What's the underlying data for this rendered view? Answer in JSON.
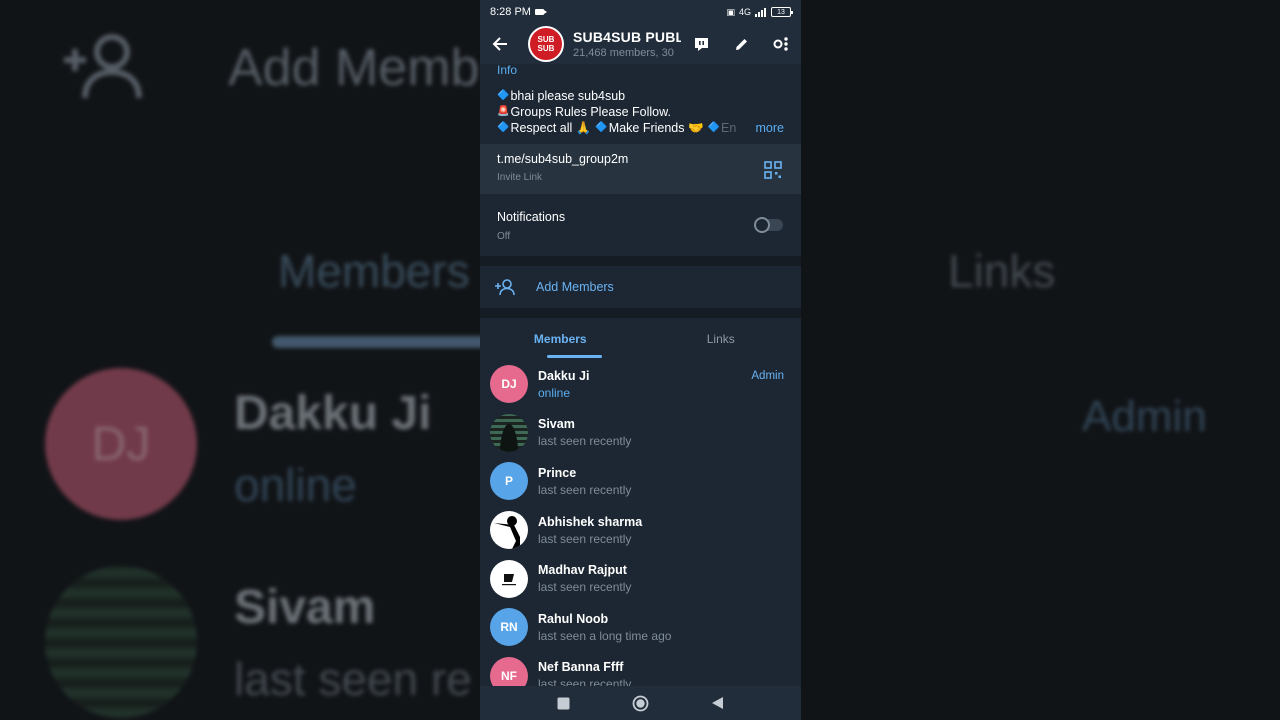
{
  "background": {
    "add_members_label": "Add Memb",
    "tab_members": "Members",
    "tab_links": "Links",
    "dj_initials": "DJ",
    "member1_name": "Dakku Ji",
    "member1_status": "online",
    "member1_role": "Admin",
    "member2_name": "Sivam",
    "member2_status": "last seen re"
  },
  "statusbar": {
    "time": "8:28 PM",
    "network": "4G",
    "battery": "13"
  },
  "header": {
    "avatar_top": "SUB",
    "avatar_bottom": "SUB",
    "title": "SUB4SUB PUBL",
    "subtitle": "21,468 members, 30"
  },
  "info": {
    "label": "Info",
    "line1": "bhai please sub4sub",
    "line2": "Groups Rules Please Follow.",
    "line3a": "Respect all 🙏",
    "line3b": "Make Friends 🤝",
    "line3c": "En",
    "more": "more"
  },
  "invite": {
    "link": "t.me/sub4sub_group2m",
    "label": "Invite Link"
  },
  "notifications": {
    "label": "Notifications",
    "value": "Off",
    "enabled": false
  },
  "add_members": {
    "label": "Add Members"
  },
  "tabs": {
    "members": "Members",
    "links": "Links",
    "active": "members"
  },
  "members": [
    {
      "initials": "DJ",
      "name": "Dakku Ji",
      "status": "online",
      "role": "Admin",
      "color": "#e56a8d"
    },
    {
      "initials": "",
      "name": "Sivam",
      "status": "last seen recently",
      "role": "",
      "color": "#2b3a33"
    },
    {
      "initials": "P",
      "name": "Prince",
      "status": "last seen recently",
      "role": "",
      "color": "#58a4e8"
    },
    {
      "initials": "",
      "name": "Abhishek sharma",
      "status": "last seen recently",
      "role": "",
      "color": "#ffffff"
    },
    {
      "initials": "",
      "name": "Madhav Rajput",
      "status": "last seen recently",
      "role": "",
      "color": "#ffffff"
    },
    {
      "initials": "RN",
      "name": "Rahul Noob",
      "status": "last seen a long time ago",
      "role": "",
      "color": "#58a4e8"
    },
    {
      "initials": "NF",
      "name": "Nef Banna Ffff",
      "status": "last seen recently",
      "role": "",
      "color": "#e56a8d"
    }
  ],
  "colors": {
    "accent": "#6ab3f3",
    "background": "#1d2733",
    "header": "#212d3b"
  }
}
